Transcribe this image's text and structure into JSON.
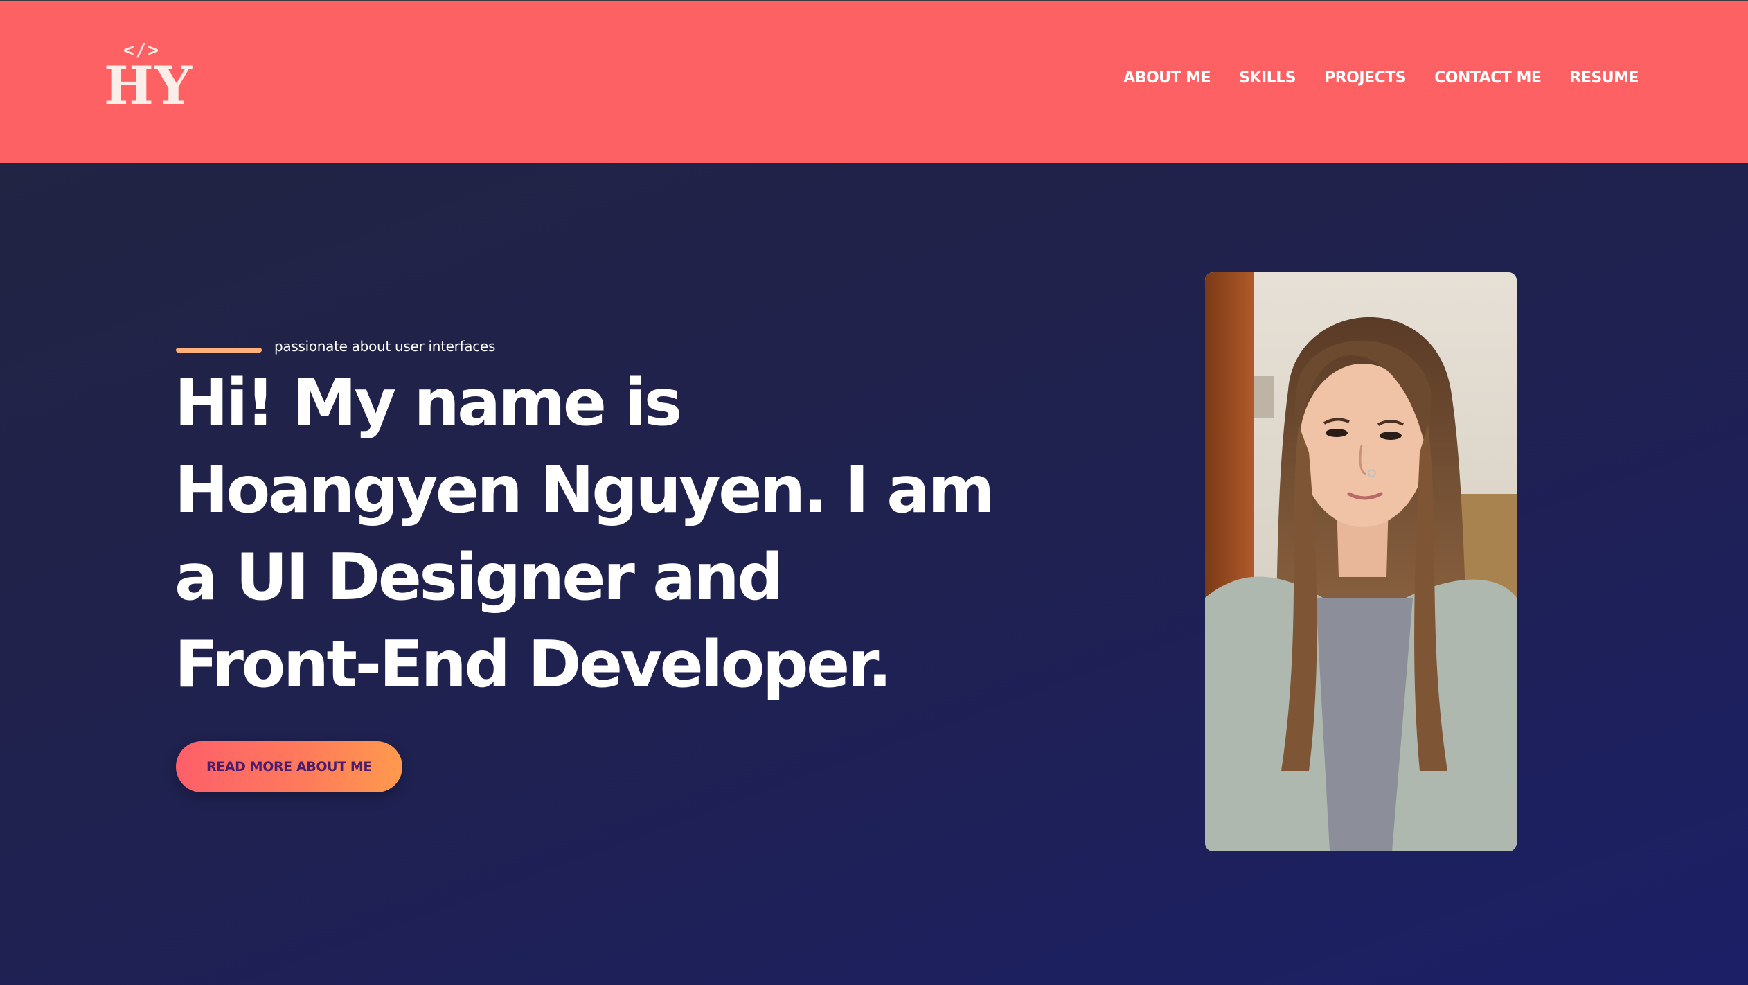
{
  "logo": {
    "code_symbol": "</>",
    "initials": "HY"
  },
  "nav": {
    "items": [
      {
        "label": "ABOUT ME"
      },
      {
        "label": "SKILLS"
      },
      {
        "label": "PROJECTS"
      },
      {
        "label": "CONTACT ME"
      },
      {
        "label": "RESUME"
      }
    ]
  },
  "hero": {
    "tagline": "passionate about user interfaces",
    "headline_lines": [
      "Hi! My name is",
      "Hoangyen Nguyen. I am",
      "a UI Designer and",
      "Front-End Developer."
    ],
    "cta_label": "READ MORE ABOUT ME",
    "photo_alt": "portrait photo"
  },
  "colors": {
    "header_bg": "#fe6163",
    "page_bg_start": "#222440",
    "page_bg_end": "#1c1f66",
    "accent_line": "#ffb07a",
    "cta_text": "#4b1d6b"
  }
}
